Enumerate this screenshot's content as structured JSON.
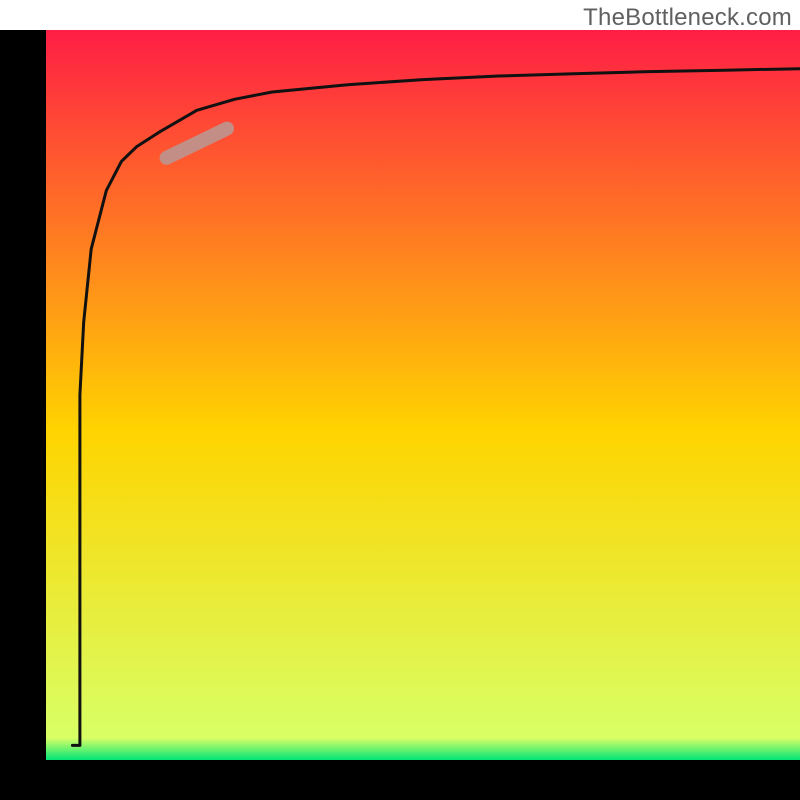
{
  "watermark": "TheBottleneck.com",
  "chart_data": {
    "type": "line",
    "title": "",
    "xlabel": "",
    "ylabel": "",
    "xlim": [
      0,
      100
    ],
    "ylim": [
      0,
      100
    ],
    "background_gradient": {
      "top_color": "#ff1e45",
      "mid_color": "#ffd400",
      "bottom_color": "#00e676"
    },
    "series": [
      {
        "name": "primary-curve",
        "color": "#111111",
        "x": [
          3.5,
          4.5,
          4.5,
          5,
          6,
          8,
          10,
          12,
          15,
          20,
          25,
          30,
          40,
          50,
          60,
          70,
          80,
          90,
          100
        ],
        "y": [
          2,
          2,
          50,
          60,
          70,
          78,
          82,
          84,
          86,
          89,
          90.5,
          91.5,
          92.5,
          93.2,
          93.7,
          94,
          94.3,
          94.5,
          94.7
        ]
      }
    ],
    "highlight_segment": {
      "name": "highlight-band",
      "color": "#c38e86",
      "x": [
        16,
        24
      ],
      "y": [
        82.5,
        86.5
      ]
    },
    "axes": {
      "x_axis_visible": true,
      "y_axis_visible": true,
      "x_ticks_visible": false,
      "y_ticks_visible": false
    }
  }
}
